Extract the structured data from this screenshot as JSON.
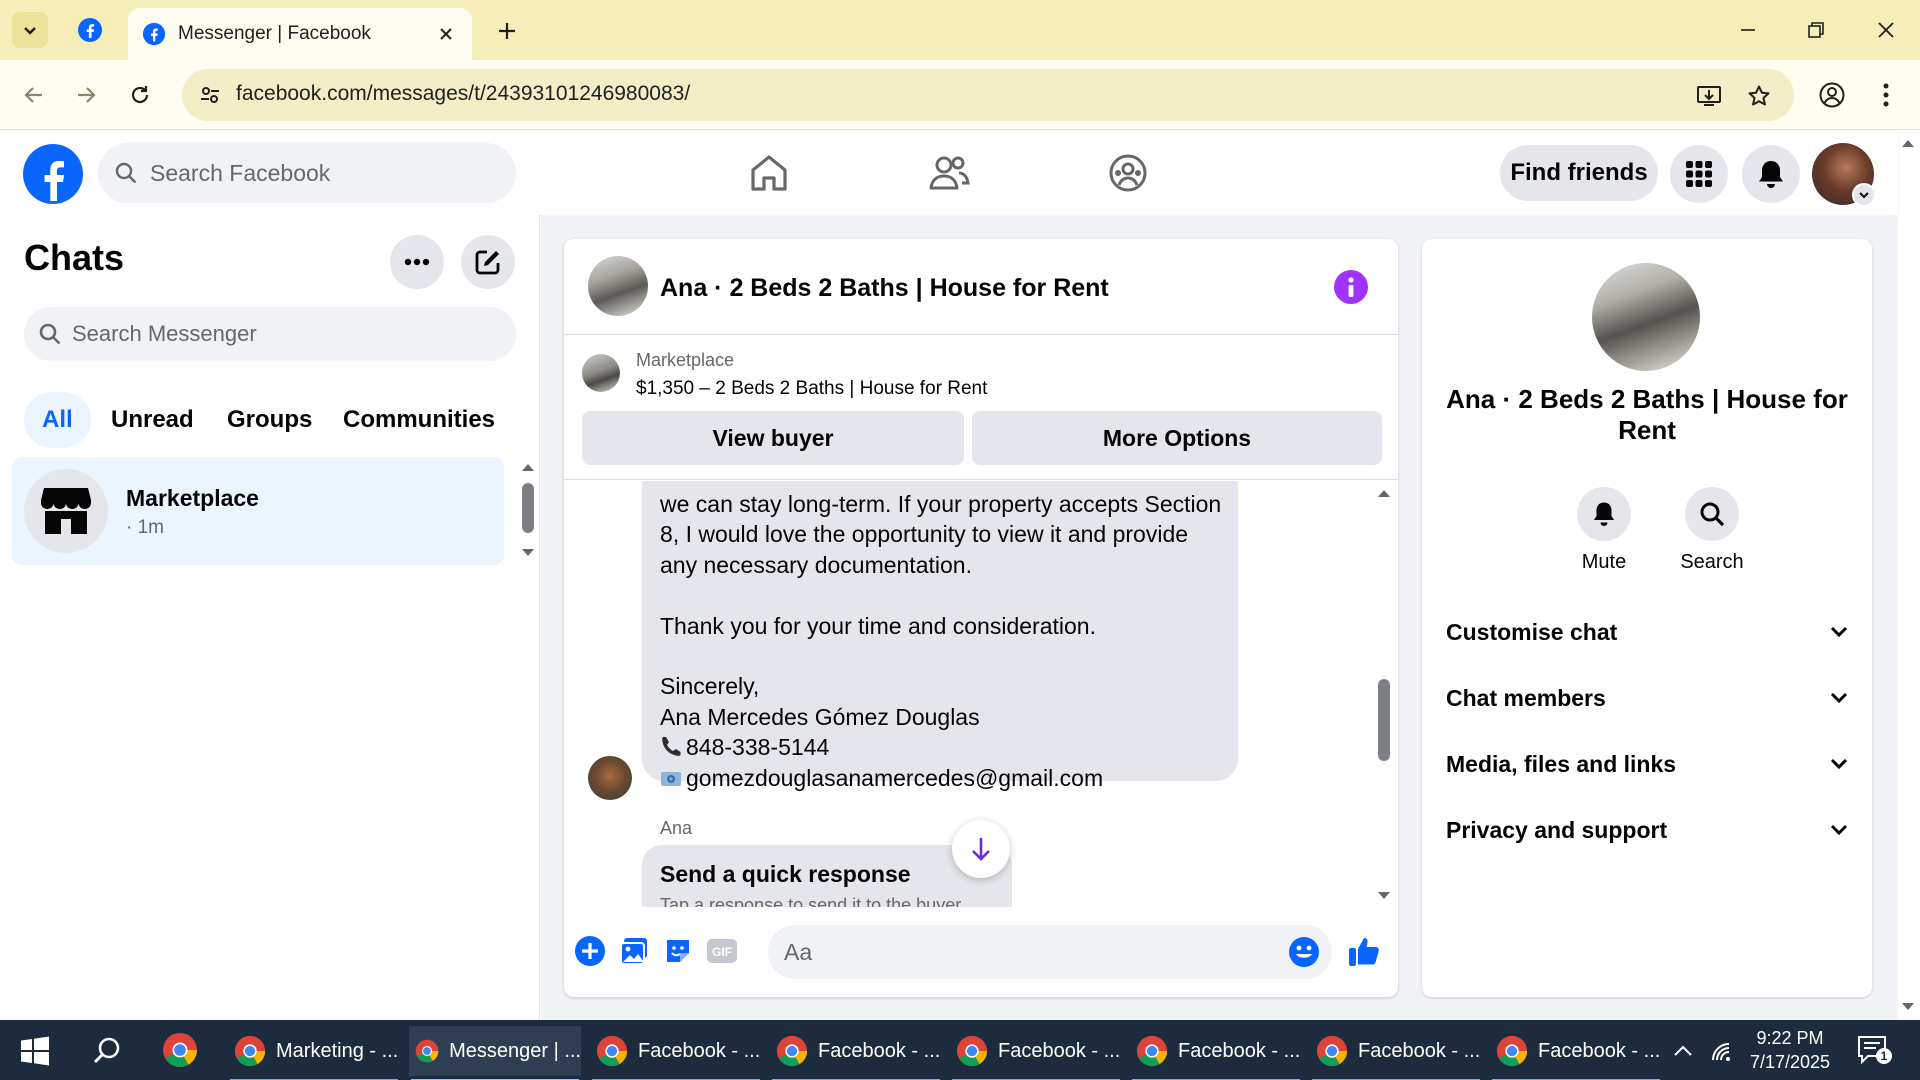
{
  "browser": {
    "tab_title": "Messenger | Facebook",
    "url": "facebook.com/messages/t/24393101246980083/"
  },
  "fb": {
    "search_placeholder": "Search Facebook",
    "find_friends": "Find friends"
  },
  "sidebar": {
    "title": "Chats",
    "search_placeholder": "Search Messenger",
    "filters": [
      "All",
      "Unread",
      "Groups",
      "Communities"
    ],
    "active_filter": "All",
    "chats": [
      {
        "name": "Marketplace",
        "time": "· 1m"
      }
    ]
  },
  "conversation": {
    "title": "Ana · 2 Beds 2 Baths | House for Rent",
    "listing": {
      "label": "Marketplace",
      "title": "$1,350 – 2 Beds 2 Baths | House for Rent",
      "buttons": [
        "View buyer",
        "More Options"
      ]
    },
    "message_lines": [
      "we can stay long-term. If your property accepts Section",
      "8, I would love the opportunity to view it and provide",
      "any necessary documentation.",
      "",
      "Thank you for your time and consideration.",
      "",
      "Sincerely,",
      "Ana Mercedes Gómez Douglas"
    ],
    "phone": "848-338-5144",
    "email": "gomezdouglasanamercedes@gmail.com",
    "sender": "Ana",
    "quick_response": {
      "title": "Send a quick response",
      "subtitle": "Tap a response to send it to the buyer"
    },
    "composer_placeholder": "Aa"
  },
  "info_panel": {
    "name": "Ana · 2 Beds 2 Baths | House for Rent",
    "actions": [
      "Mute",
      "Search"
    ],
    "sections": [
      "Customise chat",
      "Chat members",
      "Media, files and links",
      "Privacy and support"
    ]
  },
  "taskbar": {
    "apps": [
      {
        "label": "Marketing - ..."
      },
      {
        "label": "Messenger | ..."
      },
      {
        "label": "Facebook - ..."
      },
      {
        "label": "Facebook - ..."
      },
      {
        "label": "Facebook - ..."
      },
      {
        "label": "Facebook - ..."
      },
      {
        "label": "Facebook - ..."
      },
      {
        "label": "Facebook - ..."
      }
    ],
    "time": "9:22 PM",
    "date": "7/17/2025",
    "notification_count": "1"
  },
  "colors": {
    "fb_blue": "#0866ff",
    "messenger_purple": "#a033ff",
    "chrome_tabstrip": "#f5eeb9",
    "taskbar": "#1c2b3d"
  }
}
